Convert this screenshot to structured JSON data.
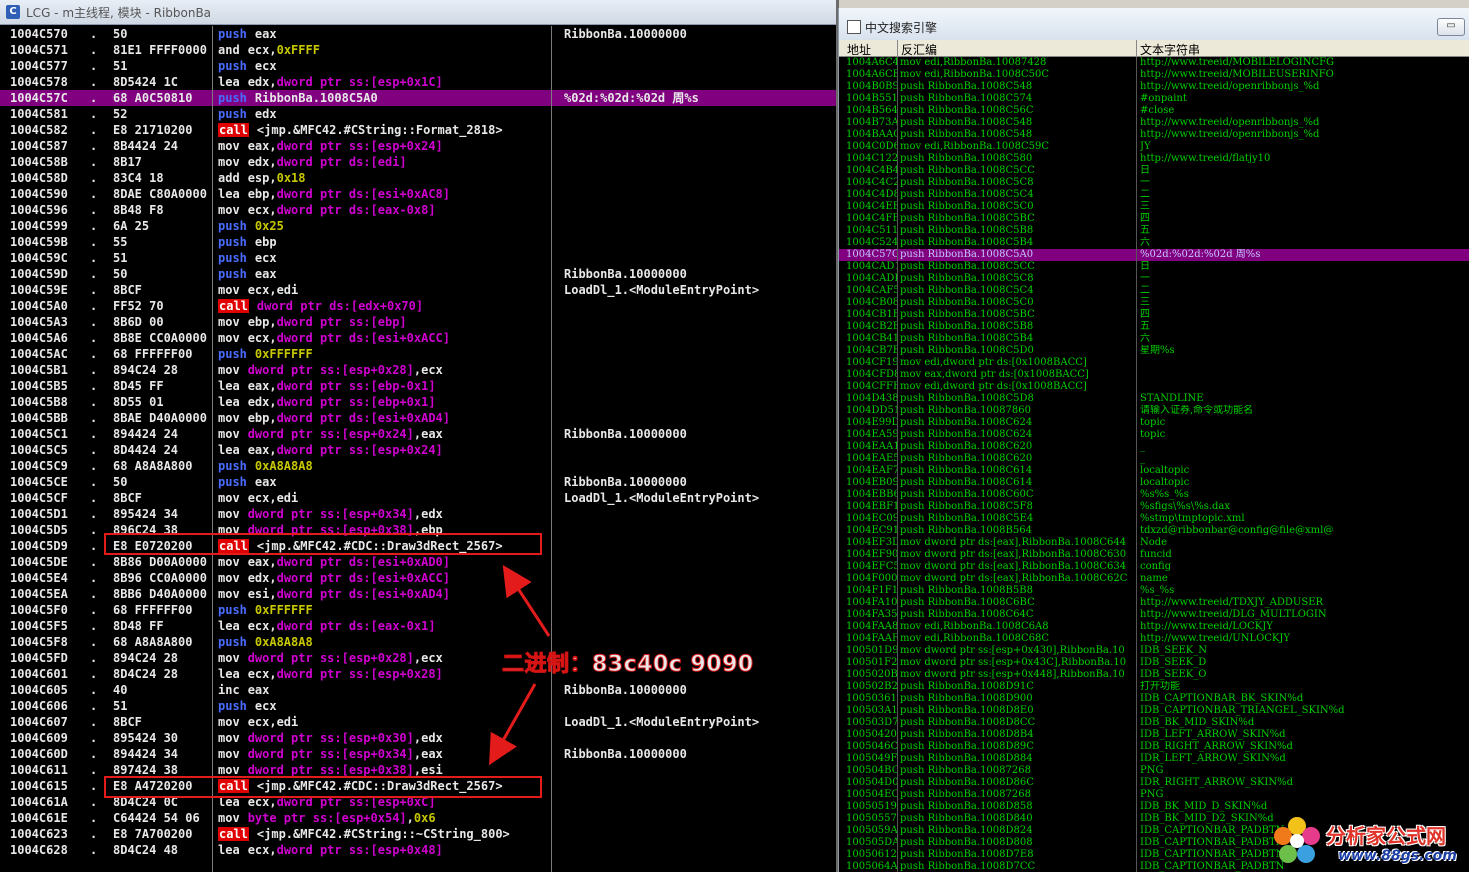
{
  "left_window": {
    "title": "LCG - m主线程, 模块 - RibbonBa",
    "icon": "window-app-icon",
    "rows": [
      {
        "addr": "1004C570",
        "dot": ".",
        "hex": "50",
        "mn": "push",
        "op": "eax",
        "cmt": "RibbonBa.10000000"
      },
      {
        "addr": "1004C571",
        "dot": ".",
        "hex": "81E1 FFFF0000",
        "mn": "and",
        "op": "ecx,0xFFFF",
        "cmt": ""
      },
      {
        "addr": "1004C577",
        "dot": ".",
        "hex": "51",
        "mn": "push",
        "op": "ecx",
        "cmt": ""
      },
      {
        "addr": "1004C578",
        "dot": ".",
        "hex": "8D5424 1C",
        "mn": "lea",
        "op": "edx,dword ptr ss:[esp+0x1C]",
        "cmt": ""
      },
      {
        "addr": "1004C57C",
        "dot": ".",
        "hex": "68 A0C50810",
        "mn": "push",
        "op": "RibbonBa.1008C5A0",
        "cmt": "%02d:%02d:%02d 周%s",
        "hl": true
      },
      {
        "addr": "1004C581",
        "dot": ".",
        "hex": "52",
        "mn": "push",
        "op": "edx",
        "cmt": ""
      },
      {
        "addr": "1004C582",
        "dot": ".",
        "hex": "E8 21710200",
        "mn": "call",
        "op": "<jmp.&MFC42.#CString::Format_2818>",
        "cmt": ""
      },
      {
        "addr": "1004C587",
        "dot": ".",
        "hex": "8B4424 24",
        "mn": "mov",
        "op": "eax,dword ptr ss:[esp+0x24]",
        "cmt": ""
      },
      {
        "addr": "1004C58B",
        "dot": ".",
        "hex": "8B17",
        "mn": "mov",
        "op": "edx,dword ptr ds:[edi]",
        "cmt": ""
      },
      {
        "addr": "1004C58D",
        "dot": ".",
        "hex": "83C4 18",
        "mn": "add",
        "op": "esp,0x18",
        "cmt": ""
      },
      {
        "addr": "1004C590",
        "dot": ".",
        "hex": "8DAE C80A0000",
        "mn": "lea",
        "op": "ebp,dword ptr ds:[esi+0xAC8]",
        "cmt": ""
      },
      {
        "addr": "1004C596",
        "dot": ".",
        "hex": "8B48 F8",
        "mn": "mov",
        "op": "ecx,dword ptr ds:[eax-0x8]",
        "cmt": ""
      },
      {
        "addr": "1004C599",
        "dot": ".",
        "hex": "6A 25",
        "mn": "push",
        "op": "0x25",
        "cmt": ""
      },
      {
        "addr": "1004C59B",
        "dot": ".",
        "hex": "55",
        "mn": "push",
        "op": "ebp",
        "cmt": ""
      },
      {
        "addr": "1004C59C",
        "dot": ".",
        "hex": "51",
        "mn": "push",
        "op": "ecx",
        "cmt": ""
      },
      {
        "addr": "1004C59D",
        "dot": ".",
        "hex": "50",
        "mn": "push",
        "op": "eax",
        "cmt": "RibbonBa.10000000"
      },
      {
        "addr": "1004C59E",
        "dot": ".",
        "hex": "8BCF",
        "mn": "mov",
        "op": "ecx,edi",
        "cmt": "LoadDl_1.<ModuleEntryPoint>"
      },
      {
        "addr": "1004C5A0",
        "dot": ".",
        "hex": "FF52 70",
        "mn": "call",
        "op": "dword ptr ds:[edx+0x70]",
        "cmt": ""
      },
      {
        "addr": "1004C5A3",
        "dot": ".",
        "hex": "8B6D 00",
        "mn": "mov",
        "op": "ebp,dword ptr ss:[ebp]",
        "cmt": ""
      },
      {
        "addr": "1004C5A6",
        "dot": ".",
        "hex": "8B8E CC0A0000",
        "mn": "mov",
        "op": "ecx,dword ptr ds:[esi+0xACC]",
        "cmt": ""
      },
      {
        "addr": "1004C5AC",
        "dot": ".",
        "hex": "68 FFFFFF00",
        "mn": "push",
        "op": "0xFFFFFF",
        "cmt": ""
      },
      {
        "addr": "1004C5B1",
        "dot": ".",
        "hex": "894C24 28",
        "mn": "mov",
        "op": "dword ptr ss:[esp+0x28],ecx",
        "cmt": ""
      },
      {
        "addr": "1004C5B5",
        "dot": ".",
        "hex": "8D45 FF",
        "mn": "lea",
        "op": "eax,dword ptr ss:[ebp-0x1]",
        "cmt": ""
      },
      {
        "addr": "1004C5B8",
        "dot": ".",
        "hex": "8D55 01",
        "mn": "lea",
        "op": "edx,dword ptr ss:[ebp+0x1]",
        "cmt": ""
      },
      {
        "addr": "1004C5BB",
        "dot": ".",
        "hex": "8BAE D40A0000",
        "mn": "mov",
        "op": "ebp,dword ptr ds:[esi+0xAD4]",
        "cmt": ""
      },
      {
        "addr": "1004C5C1",
        "dot": ".",
        "hex": "894424 24",
        "mn": "mov",
        "op": "dword ptr ss:[esp+0x24],eax",
        "cmt": "RibbonBa.10000000"
      },
      {
        "addr": "1004C5C5",
        "dot": ".",
        "hex": "8D4424 24",
        "mn": "lea",
        "op": "eax,dword ptr ss:[esp+0x24]",
        "cmt": ""
      },
      {
        "addr": "1004C5C9",
        "dot": ".",
        "hex": "68 A8A8A800",
        "mn": "push",
        "op": "0xA8A8A8",
        "cmt": ""
      },
      {
        "addr": "1004C5CE",
        "dot": ".",
        "hex": "50",
        "mn": "push",
        "op": "eax",
        "cmt": "RibbonBa.10000000"
      },
      {
        "addr": "1004C5CF",
        "dot": ".",
        "hex": "8BCF",
        "mn": "mov",
        "op": "ecx,edi",
        "cmt": "LoadDl_1.<ModuleEntryPoint>"
      },
      {
        "addr": "1004C5D1",
        "dot": ".",
        "hex": "895424 34",
        "mn": "mov",
        "op": "dword ptr ss:[esp+0x34],edx",
        "cmt": ""
      },
      {
        "addr": "1004C5D5",
        "dot": ".",
        "hex": "896C24 38",
        "mn": "mov",
        "op": "dword ptr ss:[esp+0x38],ebp",
        "cmt": ""
      },
      {
        "addr": "1004C5D9",
        "dot": ".",
        "hex": "E8 E0720200",
        "mn": "call",
        "op": "<jmp.&MFC42.#CDC::Draw3dRect_2567>",
        "cmt": ""
      },
      {
        "addr": "1004C5DE",
        "dot": ".",
        "hex": "8B86 D00A0000",
        "mn": "mov",
        "op": "eax,dword ptr ds:[esi+0xAD0]",
        "cmt": ""
      },
      {
        "addr": "1004C5E4",
        "dot": ".",
        "hex": "8B96 CC0A0000",
        "mn": "mov",
        "op": "edx,dword ptr ds:[esi+0xACC]",
        "cmt": ""
      },
      {
        "addr": "1004C5EA",
        "dot": ".",
        "hex": "8BB6 D40A0000",
        "mn": "mov",
        "op": "esi,dword ptr ds:[esi+0xAD4]",
        "cmt": ""
      },
      {
        "addr": "1004C5F0",
        "dot": ".",
        "hex": "68 FFFFFF00",
        "mn": "push",
        "op": "0xFFFFFF",
        "cmt": ""
      },
      {
        "addr": "1004C5F5",
        "dot": ".",
        "hex": "8D48 FF",
        "mn": "lea",
        "op": "ecx,dword ptr ds:[eax-0x1]",
        "cmt": ""
      },
      {
        "addr": "1004C5F8",
        "dot": ".",
        "hex": "68 A8A8A800",
        "mn": "push",
        "op": "0xA8A8A8",
        "cmt": ""
      },
      {
        "addr": "1004C5FD",
        "dot": ".",
        "hex": "894C24 28",
        "mn": "mov",
        "op": "dword ptr ss:[esp+0x28],ecx",
        "cmt": ""
      },
      {
        "addr": "1004C601",
        "dot": ".",
        "hex": "8D4C24 28",
        "mn": "lea",
        "op": "ecx,dword ptr ss:[esp+0x28]",
        "cmt": ""
      },
      {
        "addr": "1004C605",
        "dot": ".",
        "hex": "40",
        "mn": "inc",
        "op": "eax",
        "cmt": "RibbonBa.10000000"
      },
      {
        "addr": "1004C606",
        "dot": ".",
        "hex": "51",
        "mn": "push",
        "op": "ecx",
        "cmt": ""
      },
      {
        "addr": "1004C607",
        "dot": ".",
        "hex": "8BCF",
        "mn": "mov",
        "op": "ecx,edi",
        "cmt": "LoadDl_1.<ModuleEntryPoint>"
      },
      {
        "addr": "1004C609",
        "dot": ".",
        "hex": "895424 30",
        "mn": "mov",
        "op": "dword ptr ss:[esp+0x30],edx",
        "cmt": ""
      },
      {
        "addr": "1004C60D",
        "dot": ".",
        "hex": "894424 34",
        "mn": "mov",
        "op": "dword ptr ss:[esp+0x34],eax",
        "cmt": "RibbonBa.10000000"
      },
      {
        "addr": "1004C611",
        "dot": ".",
        "hex": "897424 38",
        "mn": "mov",
        "op": "dword ptr ss:[esp+0x38],esi",
        "cmt": ""
      },
      {
        "addr": "1004C615",
        "dot": ".",
        "hex": "E8 A4720200",
        "mn": "call",
        "op": "<jmp.&MFC42.#CDC::Draw3dRect_2567>",
        "cmt": ""
      },
      {
        "addr": "1004C61A",
        "dot": ".",
        "hex": "8D4C24 0C",
        "mn": "lea",
        "op": "ecx,dword ptr ss:[esp+0xC]",
        "cmt": ""
      },
      {
        "addr": "1004C61E",
        "dot": ".",
        "hex": "C64424 54 06",
        "mn": "mov",
        "op": "byte ptr ss:[esp+0x54],0x6",
        "cmt": ""
      },
      {
        "addr": "1004C623",
        "dot": ".",
        "hex": "E8 7A700200",
        "mn": "call",
        "op": "<jmp.&MFC42.#CString::~CString_800>",
        "cmt": ""
      },
      {
        "addr": "1004C628",
        "dot": ".",
        "hex": "8D4C24 48",
        "mn": "lea",
        "op": "ecx,dword ptr ss:[esp+0x48]",
        "cmt": ""
      }
    ]
  },
  "annotation": {
    "text": "二进制：83c40c 9090",
    "red": "#e31b1b"
  },
  "right_window": {
    "title": "中文搜索引擎",
    "button_label": "▭",
    "headers": [
      "地址",
      "反汇编",
      "文本字符串"
    ],
    "rows": [
      [
        "1004A6C4",
        "mov edi,RibbonBa.10087428",
        "http://www.treeid/MOBILELOGINCFG"
      ],
      [
        "1004A6CE",
        "mov edi,RibbonBa.1008C50C",
        "http://www.treeid/MOBILEUSERINFO"
      ],
      [
        "1004B0B9",
        "push RibbonBa.1008C548",
        "http://www.treeid/openribbonjs_%d"
      ],
      [
        "1004B551",
        "push RibbonBa.1008C574",
        "#onpaint"
      ],
      [
        "1004B564",
        "push RibbonBa.1008C56C",
        "#close"
      ],
      [
        "1004B73A",
        "push RibbonBa.1008C548",
        "http://www.treeid/openribbonjs_%d"
      ],
      [
        "1004BAAC",
        "push RibbonBa.1008C548",
        "http://www.treeid/openribbonjs_%d"
      ],
      [
        "1004C0D6",
        "mov edi,RibbonBa.1008C59C",
        "JY"
      ],
      [
        "1004C122",
        "push RibbonBa.1008C580",
        "http://www.treeid/flatjy10"
      ],
      [
        "1004C4B4",
        "push RibbonBa.1008C5CC",
        "日"
      ],
      [
        "1004C4C2",
        "push RibbonBa.1008C5C8",
        "一"
      ],
      [
        "1004C4D8",
        "push RibbonBa.1008C5C4",
        "二"
      ],
      [
        "1004C4EB",
        "push RibbonBa.1008C5C0",
        "三"
      ],
      [
        "1004C4FE",
        "push RibbonBa.1008C5BC",
        "四"
      ],
      [
        "1004C511",
        "push RibbonBa.1008C5B8",
        "五"
      ],
      [
        "1004C524",
        "push RibbonBa.1008C5B4",
        "六"
      ],
      [
        "1004C57C",
        "push RibbonBa.1008C5A0",
        "%02d:%02d:%02d 周%s"
      ],
      [
        "1004CAD1",
        "push RibbonBa.1008C5CC",
        "日"
      ],
      [
        "1004CADF",
        "push RibbonBa.1008C5C8",
        "一"
      ],
      [
        "1004CAF5",
        "push RibbonBa.1008C5C4",
        "二"
      ],
      [
        "1004CB08",
        "push RibbonBa.1008C5C0",
        "三"
      ],
      [
        "1004CB1B",
        "push RibbonBa.1008C5BC",
        "四"
      ],
      [
        "1004CB2E",
        "push RibbonBa.1008C5B8",
        "五"
      ],
      [
        "1004CB41",
        "push RibbonBa.1008C5B4",
        "六"
      ],
      [
        "1004CB7B",
        "push RibbonBa.1008C5D0",
        "星期%s"
      ],
      [
        "1004CF19",
        "mov edi,dword ptr ds:[0x1008BACC]",
        ""
      ],
      [
        "1004CFD8",
        "mov eax,dword ptr ds:[0x1008BACC]",
        ""
      ],
      [
        "1004CFFF",
        "mov edi,dword ptr ds:[0x1008BACC]",
        ""
      ],
      [
        "1004D438",
        "push RibbonBa.1008C5D8",
        "STANDLINE"
      ],
      [
        "1004DD51",
        "push RibbonBa.10087860",
        "请输入证券,命令或功能名"
      ],
      [
        "1004E99D",
        "push RibbonBa.1008C624",
        "topic"
      ],
      [
        "1004EA59",
        "push RibbonBa.1008C624",
        "topic"
      ],
      [
        "1004EAA1",
        "push RibbonBa.1008C620",
        "_"
      ],
      [
        "1004EAE5",
        "push RibbonBa.1008C620",
        "_"
      ],
      [
        "1004EAF7",
        "push RibbonBa.1008C614",
        "localtopic"
      ],
      [
        "1004EB09",
        "push RibbonBa.1008C614",
        "localtopic"
      ],
      [
        "1004EBB6",
        "push RibbonBa.1008C60C",
        "%s%s_%s"
      ],
      [
        "1004EBF1",
        "push RibbonBa.1008C5F8",
        "%sfigs\\%s\\%s.dax"
      ],
      [
        "1004EC09",
        "push RibbonBa.1008C5E4",
        "%stmp\\tmptopic.xml"
      ],
      [
        "1004EC91",
        "push RibbonBa.1008B564",
        "tdxzd@ribbonbar@config@file@xml@"
      ],
      [
        "1004EF3D",
        "mov dword ptr ds:[eax],RibbonBa.1008C644",
        "Node"
      ],
      [
        "1004EF90",
        "mov dword ptr ds:[eax],RibbonBa.1008C630",
        "funcid"
      ],
      [
        "1004EFC5",
        "mov dword ptr ds:[eax],RibbonBa.1008C634",
        "config"
      ],
      [
        "1004F000",
        "mov dword ptr ds:[eax],RibbonBa.1008C62C",
        "name"
      ],
      [
        "1004F1F1",
        "push RibbonBa.1008B5B8",
        "%s_%s"
      ],
      [
        "1004FA10",
        "push RibbonBa.1008C6BC",
        "http://www.treeid/TDXJY_ADDUSER"
      ],
      [
        "1004FA35",
        "push RibbonBa.1008C64C",
        "http://www.treeid/DLG_MULTLOGIN"
      ],
      [
        "1004FAA8",
        "mov edi,RibbonBa.1008C6A8",
        "http://www.treeid/LOCKJY"
      ],
      [
        "1004FAAF",
        "mov edi,RibbonBa.1008C68C",
        "http://www.treeid/UNLOCKJY"
      ],
      [
        "100501D9",
        "mov dword ptr ss:[esp+0x430],RibbonBa.10",
        "IDB_SEEK_N"
      ],
      [
        "100501F2",
        "mov dword ptr ss:[esp+0x43C],RibbonBa.10",
        "IDB_SEEK_D"
      ],
      [
        "1005020B",
        "mov dword ptr ss:[esp+0x448],RibbonBa.10",
        "IDB_SEEK_O"
      ],
      [
        "100502B2",
        "push RibbonBa.1008D91C",
        "打开功能"
      ],
      [
        "10050361",
        "push RibbonBa.1008D900",
        "IDB_CAPTIONBAR_BK_SKIN%d"
      ],
      [
        "100503A1",
        "push RibbonBa.1008D8E0",
        "IDB_CAPTIONBAR_TRIANGEL_SKIN%d"
      ],
      [
        "100503D7",
        "push RibbonBa.1008D8CC",
        "IDB_BK_MID_SKIN%d"
      ],
      [
        "10050420",
        "push RibbonBa.1008D8B4",
        "IDB_LEFT_ARROW_SKIN%d"
      ],
      [
        "1005046C",
        "push RibbonBa.1008D89C",
        "IDB_RIGHT_ARROW_SKIN%d"
      ],
      [
        "1005049F",
        "push RibbonBa.1008D884",
        "IDR_LEFT_ARROW_SKIN%d"
      ],
      [
        "100504BC",
        "push RibbonBa.10087268",
        "PNG"
      ],
      [
        "100504D0",
        "push RibbonBa.1008D86C",
        "IDR_RIGHT_ARROW_SKIN%d"
      ],
      [
        "100504EC",
        "push RibbonBa.10087268",
        "PNG"
      ],
      [
        "10050519",
        "push RibbonBa.1008D858",
        "IDB_BK_MID_D_SKIN%d"
      ],
      [
        "10050557",
        "push RibbonBa.1008D840",
        "IDB_BK_MID_D2_SKIN%d"
      ],
      [
        "1005059A",
        "push RibbonBa.1008D824",
        "IDB_CAPTIONBAR_PADBTN"
      ],
      [
        "100505DA",
        "push RibbonBa.1008D808",
        "IDB_CAPTIONBAR_PADBTN"
      ],
      [
        "10050612",
        "push RibbonBa.1008D7E8",
        "IDB_CAPTIONBAR_PADBTN"
      ],
      [
        "1005064A",
        "push RibbonBa.1008D7CC",
        "IDB_CAPTIONBAR_PADBTN"
      ]
    ],
    "highlight_index": 16
  },
  "watermark": {
    "cn": "分析家公式网",
    "url": "www.88gs.com"
  },
  "colors": {
    "highlight": "#800080",
    "push": "#4a6cff",
    "call_bg": "#e10000",
    "green_text": "#00d000"
  }
}
